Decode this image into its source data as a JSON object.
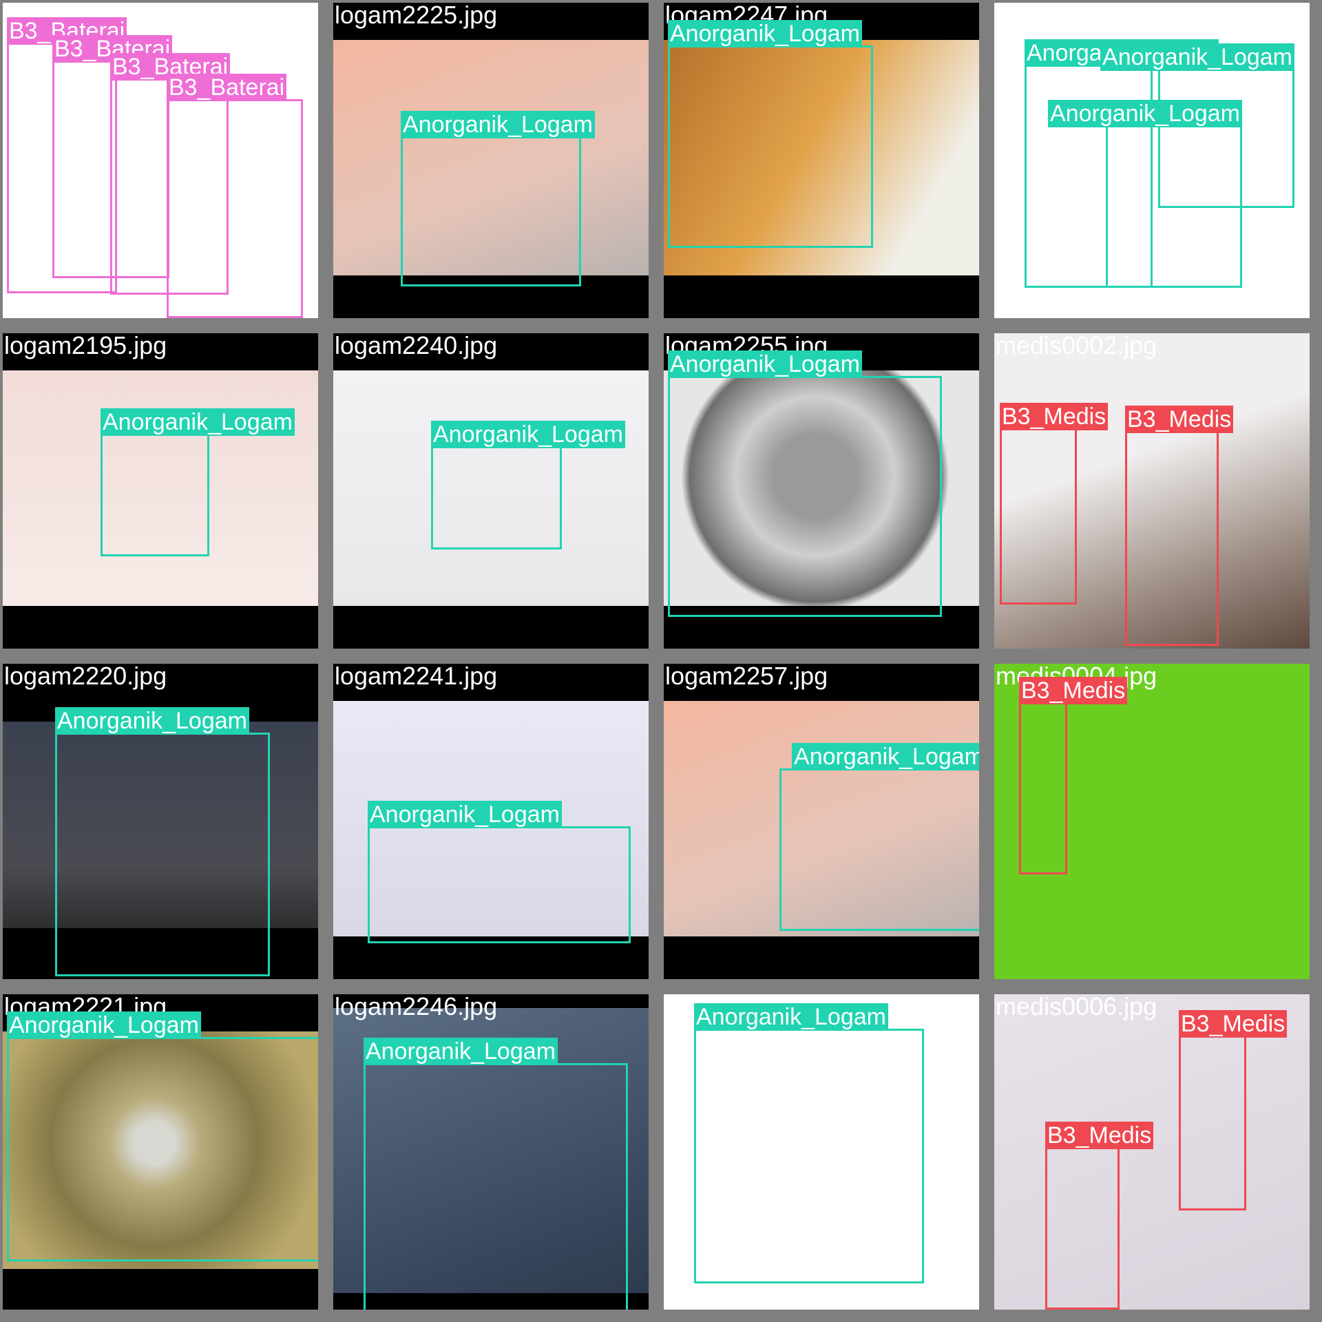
{
  "colors": {
    "B3_Baterai": "#ee6ed5",
    "Anorganik_Logam": "#21d3b1",
    "B3_Medis": "#ef4850",
    "grid_bg": "#7f7f7f"
  },
  "tiles": [
    {
      "filename": "baterai0002.jpg",
      "photo": "white",
      "detections": [
        {
          "label": "B3_Baterai"
        },
        {
          "label": "B3_Baterai"
        },
        {
          "label": "B3_Baterai"
        },
        {
          "label": "B3_Baterai"
        }
      ]
    },
    {
      "filename": "logam2225.jpg",
      "photo": "peach",
      "detections": [
        {
          "label": "Anorganik_Logam"
        }
      ]
    },
    {
      "filename": "logam2247.jpg",
      "photo": "orange",
      "detections": [
        {
          "label": "Anorganik_Logam"
        }
      ]
    },
    {
      "filename": "logam2268.jpg",
      "photo": "white",
      "detections": [
        {
          "label": "Anorganik_Logam"
        },
        {
          "label": "Anorganik_Logam"
        },
        {
          "label": "Anorganik_Logam"
        }
      ]
    },
    {
      "filename": "logam2195.jpg",
      "photo": "pink",
      "detections": [
        {
          "label": "Anorganik_Logam"
        }
      ]
    },
    {
      "filename": "logam2240.jpg",
      "photo": "grey",
      "detections": [
        {
          "label": "Anorganik_Logam"
        }
      ]
    },
    {
      "filename": "logam2255.jpg",
      "photo": "silver",
      "detections": [
        {
          "label": "Anorganik_Logam"
        }
      ]
    },
    {
      "filename": "medis0002.jpg",
      "photo": "room",
      "detections": [
        {
          "label": "B3_Medis"
        },
        {
          "label": "B3_Medis"
        }
      ]
    },
    {
      "filename": "logam2220.jpg",
      "photo": "dark",
      "detections": [
        {
          "label": "Anorganik_Logam"
        }
      ]
    },
    {
      "filename": "logam2241.jpg",
      "photo": "lavender",
      "detections": [
        {
          "label": "Anorganik_Logam"
        }
      ]
    },
    {
      "filename": "logam2257.jpg",
      "photo": "peach",
      "detections": [
        {
          "label": "Anorganik_Logam"
        }
      ]
    },
    {
      "filename": "medis0004.jpg",
      "photo": "green",
      "detections": [
        {
          "label": "B3_Medis"
        }
      ]
    },
    {
      "filename": "logam2221.jpg",
      "photo": "gold",
      "detections": [
        {
          "label": "Anorganik_Logam"
        }
      ]
    },
    {
      "filename": "logam2246.jpg",
      "photo": "blue",
      "detections": [
        {
          "label": "Anorganik_Logam"
        }
      ]
    },
    {
      "filename": "logam2254.jpg",
      "photo": "white",
      "detections": [
        {
          "label": "Anorganik_Logam"
        }
      ]
    },
    {
      "filename": "medis0006.jpg",
      "photo": "lilac",
      "detections": [
        {
          "label": "B3_Medis"
        },
        {
          "label": "B3_Medis"
        }
      ]
    }
  ]
}
